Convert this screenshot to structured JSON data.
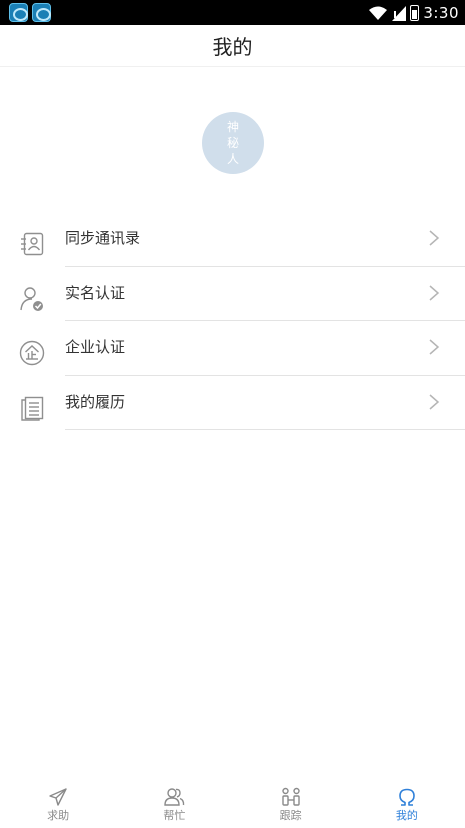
{
  "status_bar": {
    "time": "3:30"
  },
  "header": {
    "title": "我的"
  },
  "profile": {
    "avatar_text": "神秘人"
  },
  "menu": [
    {
      "label": "同步通讯录",
      "icon": "contacts-book-icon"
    },
    {
      "label": "实名认证",
      "icon": "user-verified-icon"
    },
    {
      "label": "企业认证",
      "icon": "enterprise-icon"
    },
    {
      "label": "我的履历",
      "icon": "resume-icon"
    }
  ],
  "bottom_nav": [
    {
      "label": "求助",
      "icon": "paper-plane-icon",
      "active": false
    },
    {
      "label": "帮忙",
      "icon": "people-icon",
      "active": false
    },
    {
      "label": "跟踪",
      "icon": "track-icon",
      "active": false
    },
    {
      "label": "我的",
      "icon": "omega-icon",
      "active": true
    }
  ],
  "colors": {
    "accent": "#2f80d9",
    "avatar_bg": "#d0deeb",
    "divider": "#e3e3e3"
  }
}
